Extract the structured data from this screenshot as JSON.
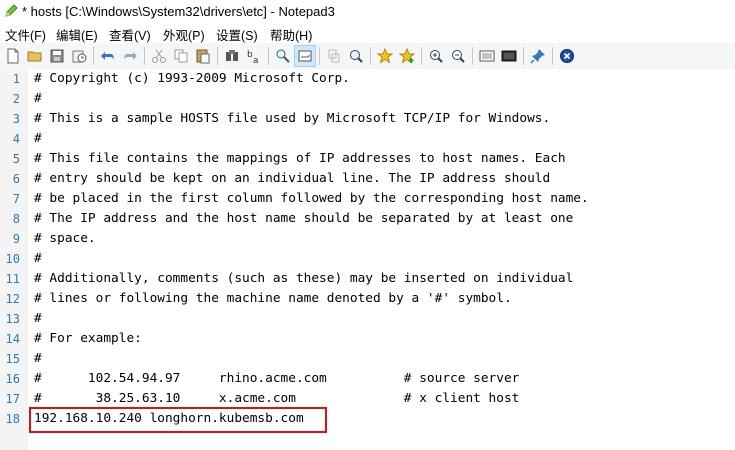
{
  "window": {
    "title": "* hosts [C:\\Windows\\System32\\drivers\\etc] - Notepad3"
  },
  "menu": {
    "items": [
      {
        "label": "文件(F)"
      },
      {
        "label": "编辑(E)"
      },
      {
        "label": "查看(V)"
      },
      {
        "label": "外观(P)"
      },
      {
        "label": "设置(S)"
      },
      {
        "label": "帮助(H)"
      }
    ]
  },
  "toolbar": {
    "buttons": [
      {
        "name": "new-file-icon"
      },
      {
        "name": "open-folder-icon"
      },
      {
        "name": "save-icon"
      },
      {
        "name": "recent-files-icon"
      },
      {
        "name": "undo-icon"
      },
      {
        "name": "redo-icon"
      },
      {
        "name": "cut-icon"
      },
      {
        "name": "copy-icon"
      },
      {
        "name": "paste-icon"
      },
      {
        "name": "find-icon"
      },
      {
        "name": "replace-icon"
      },
      {
        "name": "find-in-files-icon"
      },
      {
        "name": "word-wrap-icon"
      },
      {
        "name": "select-block-icon"
      },
      {
        "name": "zoom-search-icon"
      },
      {
        "name": "favorites-icon"
      },
      {
        "name": "add-favorite-icon"
      },
      {
        "name": "zoom-in-icon"
      },
      {
        "name": "zoom-out-icon"
      },
      {
        "name": "scheme-icon"
      },
      {
        "name": "console-icon"
      },
      {
        "name": "pin-icon"
      },
      {
        "name": "close-file-icon"
      }
    ]
  },
  "editor": {
    "lines": [
      {
        "n": "1",
        "text": "# Copyright (c) 1993-2009 Microsoft Corp."
      },
      {
        "n": "2",
        "text": "#"
      },
      {
        "n": "3",
        "text": "# This is a sample HOSTS file used by Microsoft TCP/IP for Windows."
      },
      {
        "n": "4",
        "text": "#"
      },
      {
        "n": "5",
        "text": "# This file contains the mappings of IP addresses to host names. Each"
      },
      {
        "n": "6",
        "text": "# entry should be kept on an individual line. The IP address should"
      },
      {
        "n": "7",
        "text": "# be placed in the first column followed by the corresponding host name."
      },
      {
        "n": "8",
        "text": "# The IP address and the host name should be separated by at least one"
      },
      {
        "n": "9",
        "text": "# space."
      },
      {
        "n": "10",
        "text": "#"
      },
      {
        "n": "11",
        "text": "# Additionally, comments (such as these) may be inserted on individual"
      },
      {
        "n": "12",
        "text": "# lines or following the machine name denoted by a '#' symbol."
      },
      {
        "n": "13",
        "text": "#"
      },
      {
        "n": "14",
        "text": "# For example:"
      },
      {
        "n": "15",
        "text": "#"
      },
      {
        "n": "16",
        "text": "#      102.54.94.97     rhino.acme.com          # source server"
      },
      {
        "n": "17",
        "text": "#       38.25.63.10     x.acme.com              # x client host"
      },
      {
        "n": "18",
        "text": "192.168.10.240 longhorn.kubemsb.com"
      }
    ]
  },
  "colors": {
    "line_numbers": "#2b7bb9",
    "highlight_border": "#e01010"
  }
}
